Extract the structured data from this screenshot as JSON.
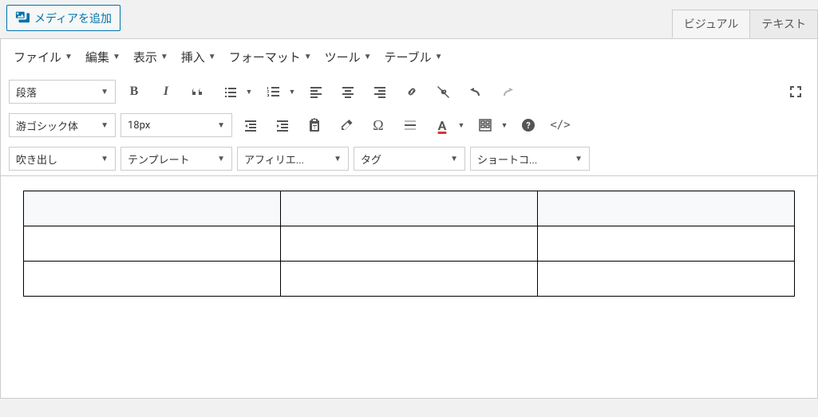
{
  "media_button": {
    "label": "メディアを追加"
  },
  "tabs": {
    "visual": "ビジュアル",
    "text": "テキスト"
  },
  "menubar": {
    "file": "ファイル",
    "edit": "編集",
    "view": "表示",
    "insert": "挿入",
    "format": "フォーマット",
    "tools": "ツール",
    "table": "テーブル"
  },
  "toolbar1": {
    "block_format": "段落"
  },
  "toolbar2": {
    "font_family": "游ゴシック体",
    "font_size": "18px"
  },
  "toolbar3": {
    "balloon": "吹き出し",
    "template": "テンプレート",
    "affiliate": "アフィリエ...",
    "tag": "タグ",
    "shortcode": "ショートコ..."
  },
  "content": {
    "table": {
      "rows": 3,
      "cols": 3
    }
  }
}
